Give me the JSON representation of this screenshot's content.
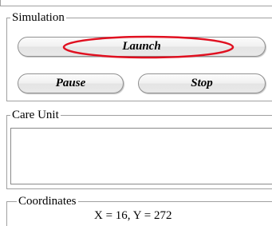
{
  "simulation": {
    "title": "Simulation",
    "launch_label": "Launch",
    "pause_label": "Pause",
    "stop_label": "Stop",
    "highlight_color": "#e01020"
  },
  "care_unit": {
    "title": "Care Unit",
    "content": ""
  },
  "coordinates": {
    "title": "Coordinates",
    "value_text": "X = 16, Y = 272"
  }
}
